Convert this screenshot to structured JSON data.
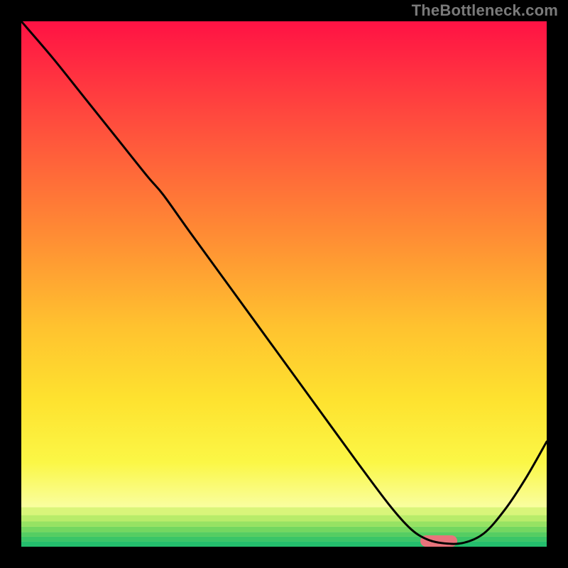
{
  "watermark": "TheBottleneck.com",
  "chart_data": {
    "type": "line",
    "title": "",
    "xlabel": "",
    "ylabel": "",
    "xlim": [
      0,
      100
    ],
    "ylim": [
      0,
      100
    ],
    "x": [
      0,
      6,
      12,
      18,
      24,
      27,
      32,
      40,
      48,
      56,
      64,
      70,
      74,
      77,
      80,
      84,
      88,
      92,
      96,
      100
    ],
    "values": {
      "name": "bottleneck-curve",
      "y": [
        100,
        93,
        85.5,
        78,
        70.5,
        67,
        60,
        49,
        38,
        27,
        16,
        8,
        3.5,
        1.5,
        0.7,
        0.7,
        2.5,
        7,
        13,
        20
      ]
    },
    "marker": {
      "x": 79.5,
      "y": 0,
      "width": 7,
      "height": 2.2,
      "color": "#e8747c"
    },
    "background_gradient": {
      "stops": [
        {
          "pos": 0.0,
          "color": "#ff1244"
        },
        {
          "pos": 0.2,
          "color": "#ff4f3d"
        },
        {
          "pos": 0.4,
          "color": "#ff8a34"
        },
        {
          "pos": 0.58,
          "color": "#ffc22f"
        },
        {
          "pos": 0.72,
          "color": "#fee22f"
        },
        {
          "pos": 0.84,
          "color": "#fbf746"
        },
        {
          "pos": 0.925,
          "color": "#f9fea0"
        }
      ]
    },
    "bottom_bands": [
      {
        "from": 0.925,
        "to": 0.94,
        "color": "#d9f57a"
      },
      {
        "from": 0.94,
        "to": 0.952,
        "color": "#b8ec6a"
      },
      {
        "from": 0.952,
        "to": 0.962,
        "color": "#96e263"
      },
      {
        "from": 0.962,
        "to": 0.972,
        "color": "#74d760"
      },
      {
        "from": 0.972,
        "to": 0.981,
        "color": "#55cd62"
      },
      {
        "from": 0.981,
        "to": 0.99,
        "color": "#3bc567"
      },
      {
        "from": 0.99,
        "to": 1.0,
        "color": "#24be6d"
      }
    ]
  }
}
